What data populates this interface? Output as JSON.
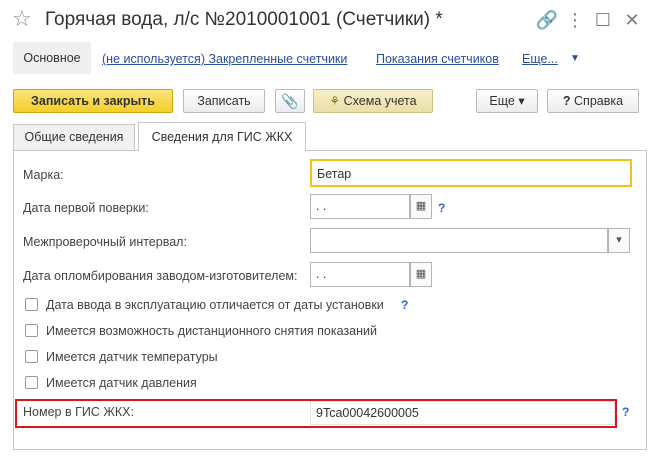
{
  "window": {
    "title": "Горячая вода, л/с №2010001001 (Счетчики) *",
    "star": "☆",
    "link_icon": "🔗",
    "menu_icon": "⋮",
    "maximize_icon": "☐",
    "close_icon": "✕"
  },
  "nav": {
    "main": "Основное",
    "links": [
      "(не используется) Закрепленные счетчики",
      "Показания счетчиков",
      "Еще..."
    ],
    "more_arrow": "▼"
  },
  "toolbar": {
    "save_close": "Записать и закрыть",
    "save": "Записать",
    "clip_icon": "📎",
    "scheme": "Схема учета",
    "more": "Еще",
    "more_arrow": "▾",
    "help": "Справка",
    "help_icon": "?"
  },
  "tabs": [
    "Общие сведения",
    "Сведения для ГИС ЖКХ"
  ],
  "form": {
    "brand_label": "Марка:",
    "brand_value": "Бетар",
    "first_check_label": "Дата первой поверки:",
    "first_check_value": " .  .",
    "interval_label": "Межпроверочный интервал:",
    "interval_value": "",
    "seal_label": "Дата опломбирования заводом-изготовителем:",
    "seal_value": " .  .",
    "help_mark": "?",
    "checkboxes": [
      "Дата ввода в эксплуатацию отличается от даты установки",
      "Имеется возможность дистанционного снятия показаний",
      "Имеется датчик температуры",
      "Имеется датчик давления"
    ],
    "gis_label": "Номер в ГИС ЖКХ:",
    "gis_value": "9Tca00042600005"
  },
  "colors": {
    "primary_button": "#f3cf28",
    "focus_border": "#f0c419",
    "link": "#2a4f9e",
    "highlight": "#e0141c"
  }
}
